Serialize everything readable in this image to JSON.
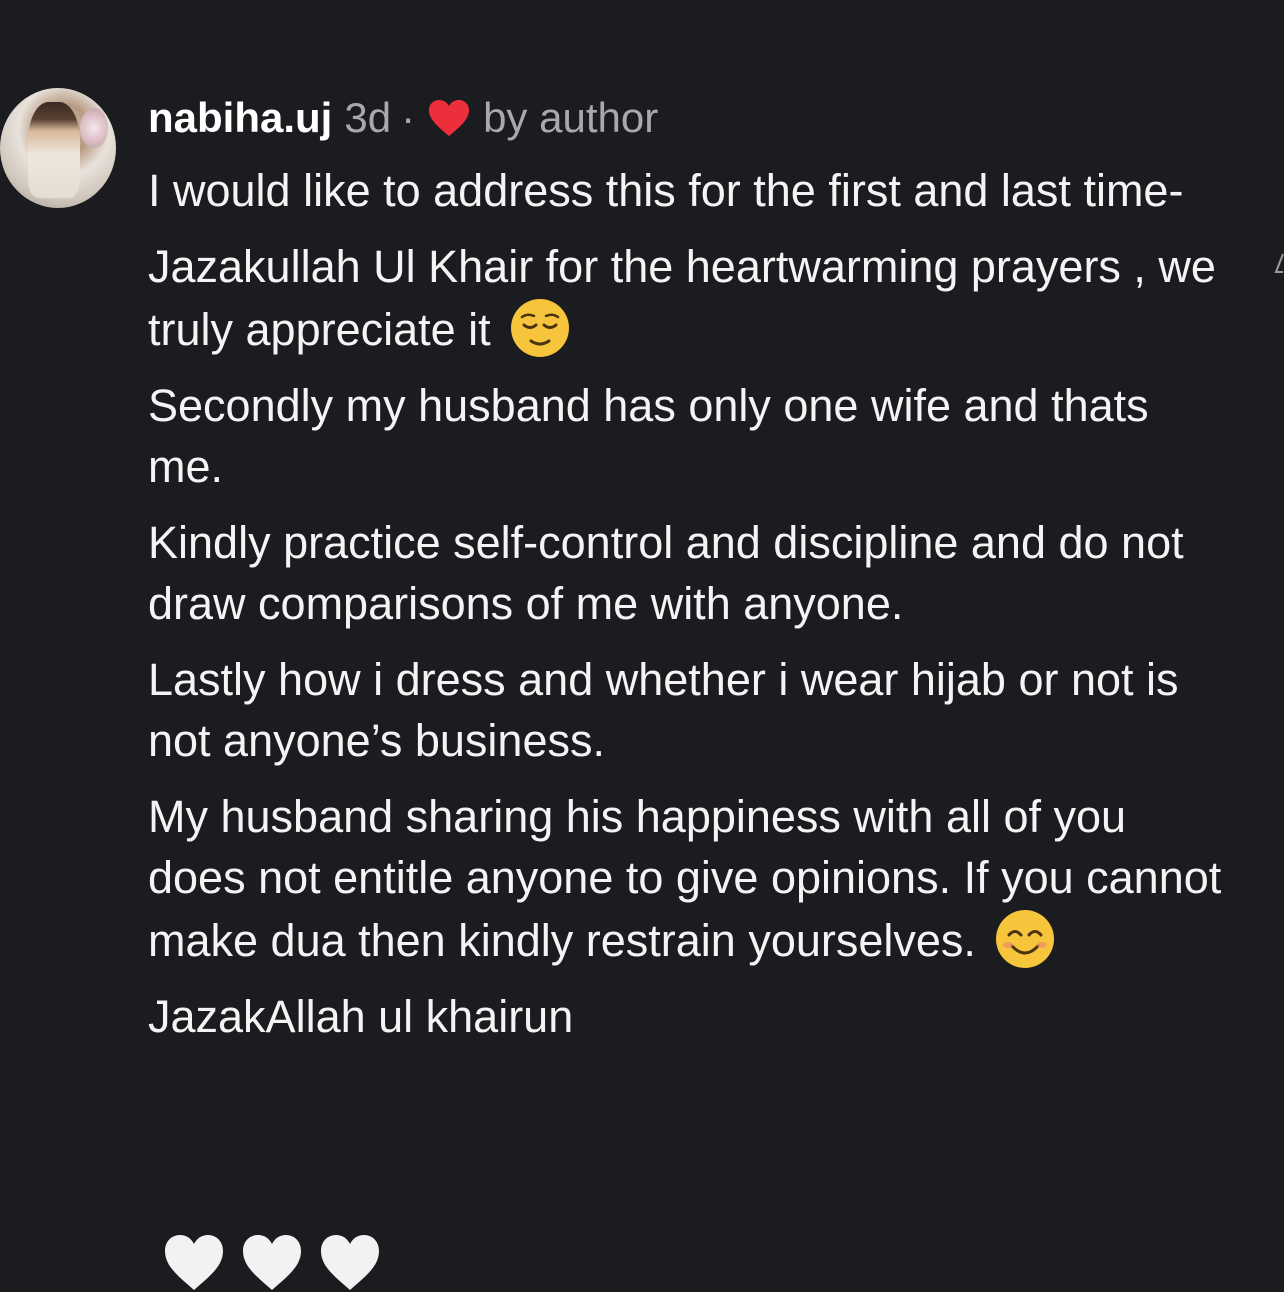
{
  "comment": {
    "username": "nabiha.uj",
    "time": "3d",
    "separator": "·",
    "liked_label": "by author",
    "paragraphs": [
      "I would like to address this for the first and last time-",
      "Jazakullah Ul Khair for the heartwarming prayers , we truly appreciate it",
      "Secondly my husband has only one wife and thats me.",
      "Kindly practice self-control and discipline and do not draw comparisons of me with anyone.",
      "Lastly how i dress and whether i wear hijab or not is not anyone’s business.",
      "My husband sharing his happiness with all of you does not entitle anyone to give opinions. If you cannot make dua then kindly restrain yourselves.",
      "JazakAllah ul khairun"
    ],
    "icons": {
      "avatar": "profile-photo-bride",
      "heart": "red-heart-icon",
      "relieved_emoji": "relieved-face-emoji",
      "smile_emoji": "smiling-face-emoji",
      "white_hearts": "white-heart-emoji"
    },
    "colors": {
      "background": "#1b1c20",
      "text": "#f4f4f4",
      "muted": "#a8a8ad",
      "heart": "#ed2f3c",
      "emoji": "#f7c53b"
    }
  }
}
